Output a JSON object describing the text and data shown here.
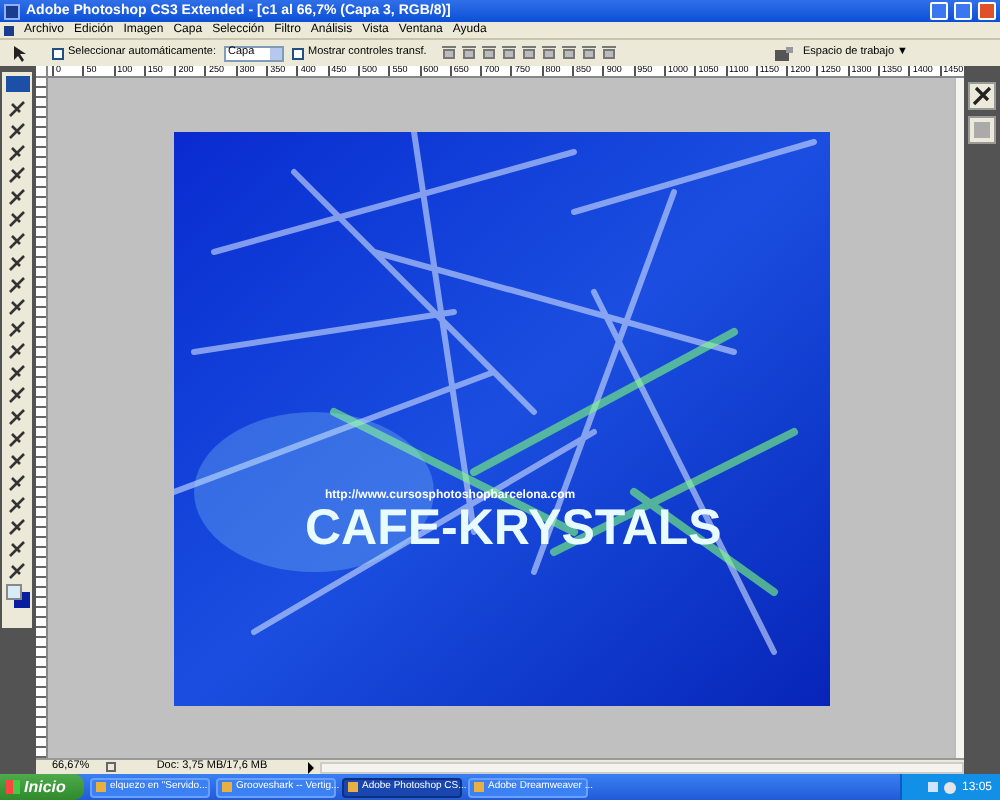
{
  "window": {
    "title": "Adobe Photoshop CS3 Extended - [c1 al 66,7% (Capa 3, RGB/8)]"
  },
  "menu": [
    "Archivo",
    "Edición",
    "Imagen",
    "Capa",
    "Selección",
    "Filtro",
    "Análisis",
    "Vista",
    "Ventana",
    "Ayuda"
  ],
  "options_bar": {
    "auto_select": {
      "label": "Seleccionar automáticamente:",
      "checked": false
    },
    "auto_select_target": "Capa",
    "show_transform": {
      "label": "Mostrar controles transf.",
      "checked": false
    },
    "workspace": "Espacio de trabajo ▼"
  },
  "ruler_labels": [
    "0",
    "50",
    "100",
    "150",
    "200",
    "250",
    "300",
    "350",
    "400",
    "450",
    "500",
    "550",
    "600",
    "650",
    "700",
    "750",
    "800",
    "850",
    "900",
    "950",
    "1000",
    "1050",
    "1100",
    "1150",
    "1200",
    "1250",
    "1300",
    "1350",
    "1400",
    "1450"
  ],
  "document": {
    "url_text": "http://www.cursosphotoshopbarcelona.com",
    "headline": "CAFE-KRYSTALS"
  },
  "status_bar": {
    "zoom": "66,67%",
    "doc_size": "Doc: 3,75 MB/17,6 MB"
  },
  "taskbar": {
    "start": "Inicio",
    "tasks": [
      {
        "label": "elquezo en \"Servido...",
        "selected": false
      },
      {
        "label": "Grooveshark -- Vertig...",
        "selected": false
      },
      {
        "label": "Adobe Photoshop CS...",
        "selected": true
      },
      {
        "label": "Adobe Dreamweaver ...",
        "selected": false
      }
    ],
    "clock": "13:05"
  }
}
